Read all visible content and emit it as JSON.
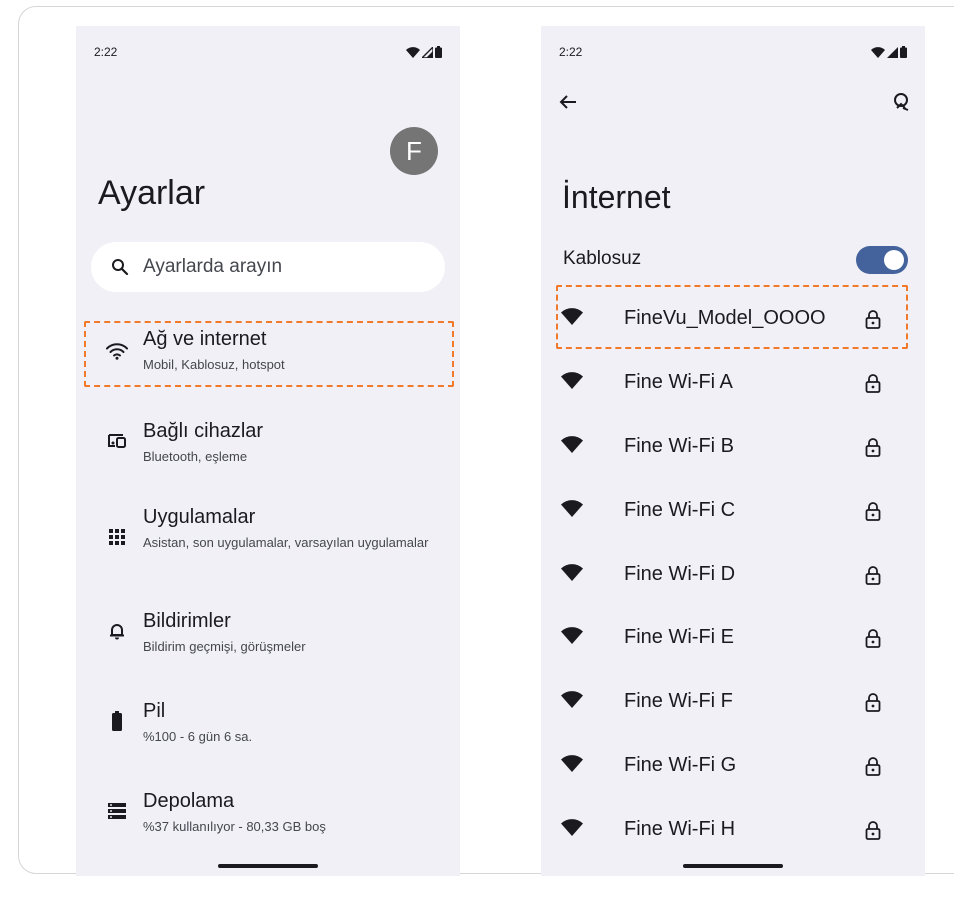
{
  "left_screen": {
    "status": {
      "time": "2:22"
    },
    "avatar_letter": "F",
    "title": "Ayarlar",
    "search": {
      "placeholder": "Ayarlarda arayın"
    },
    "items": [
      {
        "title": "Ağ ve internet",
        "subtitle": "Mobil, Kablosuz, hotspot",
        "icon": "wifi-icon"
      },
      {
        "title": "Bağlı cihazlar",
        "subtitle": "Bluetooth, eşleme",
        "icon": "devices-icon"
      },
      {
        "title": "Uygulamalar",
        "subtitle": "Asistan, son uygulamalar, varsayılan uygulamalar",
        "icon": "apps-grid-icon"
      },
      {
        "title": "Bildirimler",
        "subtitle": "Bildirim geçmişi, görüşmeler",
        "icon": "bell-icon"
      },
      {
        "title": "Pil",
        "subtitle": "%100 - 6 gün 6 sa.",
        "icon": "battery-icon"
      },
      {
        "title": "Depolama",
        "subtitle": "%37 kullanılıyor - 80,33 GB boş",
        "icon": "storage-icon"
      }
    ]
  },
  "right_screen": {
    "status": {
      "time": "2:22"
    },
    "title": "İnternet",
    "wifi_label": "Kablosuz",
    "wifi_enabled": true,
    "networks": [
      {
        "name": "FineVu_Model_OOOO",
        "secured": true
      },
      {
        "name": "Fine Wi-Fi A",
        "secured": true
      },
      {
        "name": "Fine Wi-Fi B",
        "secured": true
      },
      {
        "name": "Fine Wi-Fi C",
        "secured": true
      },
      {
        "name": "Fine Wi-Fi D",
        "secured": true
      },
      {
        "name": "Fine Wi-Fi E",
        "secured": true
      },
      {
        "name": "Fine Wi-Fi F",
        "secured": true
      },
      {
        "name": "Fine Wi-Fi G",
        "secured": true
      },
      {
        "name": "Fine Wi-Fi H",
        "secured": true
      }
    ]
  },
  "colors": {
    "screen_bg": "#f1f0f6",
    "highlight": "#f07a2a",
    "toggle_on": "#44639c",
    "avatar_bg": "#757575"
  }
}
